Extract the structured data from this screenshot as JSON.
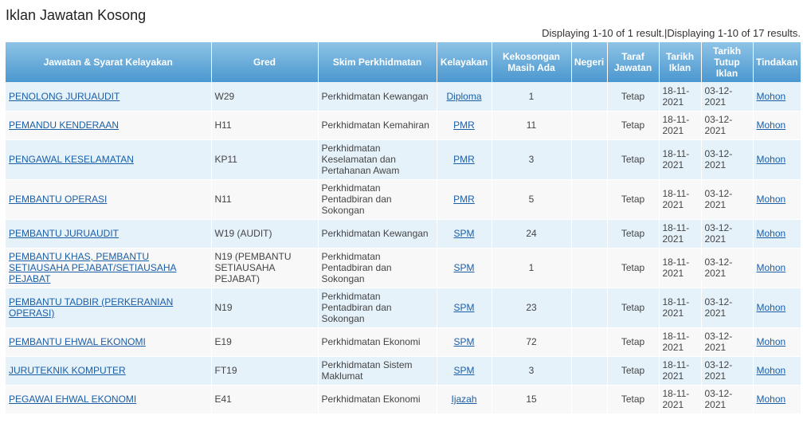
{
  "page": {
    "title": "Iklan Jawatan Kosong",
    "summary": "Displaying 1-10 of 1 result.|Displaying 1-10 of 17 results."
  },
  "table": {
    "headers": {
      "jawatan": "Jawatan & Syarat Kelayakan",
      "gred": "Gred",
      "skim": "Skim Perkhidmatan",
      "kelayakan": "Kelayakan",
      "kekosongan_1": "Kekosongan",
      "kekosongan_2": "Masih Ada",
      "negeri": "Negeri",
      "taraf_1": "Taraf",
      "taraf_2": "Jawatan",
      "tarikh_iklan_1": "Tarikh",
      "tarikh_iklan_2": "Iklan",
      "tarikh_tutup_1": "Tarikh",
      "tarikh_tutup_2": "Tutup",
      "tarikh_tutup_3": "Iklan",
      "tindakan": "Tindakan"
    },
    "rows": [
      {
        "jawatan": "PENOLONG JURUAUDIT",
        "gred": "W29",
        "skim": "Perkhidmatan Kewangan",
        "kelayakan": "Diploma",
        "kekosongan": "1",
        "negeri": "",
        "taraf": "Tetap",
        "tarikh_iklan": "18-11-2021",
        "tarikh_tutup": "03-12-2021",
        "tindakan": "Mohon"
      },
      {
        "jawatan": "PEMANDU KENDERAAN",
        "gred": "H11",
        "skim": "Perkhidmatan Kemahiran",
        "kelayakan": "PMR",
        "kekosongan": "11",
        "negeri": "",
        "taraf": "Tetap",
        "tarikh_iklan": "18-11-2021",
        "tarikh_tutup": "03-12-2021",
        "tindakan": "Mohon"
      },
      {
        "jawatan": "PENGAWAL KESELAMATAN",
        "gred": "KP11",
        "skim": "Perkhidmatan Keselamatan dan Pertahanan Awam",
        "kelayakan": "PMR",
        "kekosongan": "3",
        "negeri": "",
        "taraf": "Tetap",
        "tarikh_iklan": "18-11-2021",
        "tarikh_tutup": "03-12-2021",
        "tindakan": "Mohon"
      },
      {
        "jawatan": "PEMBANTU OPERASI",
        "gred": "N11",
        "skim": "Perkhidmatan Pentadbiran dan Sokongan",
        "kelayakan": "PMR",
        "kekosongan": "5",
        "negeri": "",
        "taraf": "Tetap",
        "tarikh_iklan": "18-11-2021",
        "tarikh_tutup": "03-12-2021",
        "tindakan": "Mohon"
      },
      {
        "jawatan": "PEMBANTU JURUAUDIT",
        "gred": "W19 (AUDIT)",
        "skim": "Perkhidmatan Kewangan",
        "kelayakan": "SPM",
        "kekosongan": "24",
        "negeri": "",
        "taraf": "Tetap",
        "tarikh_iklan": "18-11-2021",
        "tarikh_tutup": "03-12-2021",
        "tindakan": "Mohon"
      },
      {
        "jawatan": "PEMBANTU KHAS, PEMBANTU SETIAUSAHA PEJABAT/SETIAUSAHA PEJABAT",
        "gred": "N19 (PEMBANTU SETIAUSAHA PEJABAT)",
        "skim": "Perkhidmatan Pentadbiran dan Sokongan",
        "kelayakan": "SPM",
        "kekosongan": "1",
        "negeri": "",
        "taraf": "Tetap",
        "tarikh_iklan": "18-11-2021",
        "tarikh_tutup": "03-12-2021",
        "tindakan": "Mohon"
      },
      {
        "jawatan": "PEMBANTU TADBIR (PERKERANIAN OPERASI)",
        "gred": "N19",
        "skim": "Perkhidmatan Pentadbiran dan Sokongan",
        "kelayakan": "SPM",
        "kekosongan": "23",
        "negeri": "",
        "taraf": "Tetap",
        "tarikh_iklan": "18-11-2021",
        "tarikh_tutup": "03-12-2021",
        "tindakan": "Mohon"
      },
      {
        "jawatan": "PEMBANTU EHWAL EKONOMI",
        "gred": "E19",
        "skim": "Perkhidmatan Ekonomi",
        "kelayakan": "SPM",
        "kekosongan": "72",
        "negeri": "",
        "taraf": "Tetap",
        "tarikh_iklan": "18-11-2021",
        "tarikh_tutup": "03-12-2021",
        "tindakan": "Mohon"
      },
      {
        "jawatan": "JURUTEKNIK KOMPUTER",
        "gred": "FT19",
        "skim": "Perkhidmatan Sistem Maklumat",
        "kelayakan": "SPM",
        "kekosongan": "3",
        "negeri": "",
        "taraf": "Tetap",
        "tarikh_iklan": "18-11-2021",
        "tarikh_tutup": "03-12-2021",
        "tindakan": "Mohon"
      },
      {
        "jawatan": "PEGAWAI EHWAL EKONOMI",
        "gred": "E41",
        "skim": "Perkhidmatan Ekonomi",
        "kelayakan": "Ijazah",
        "kekosongan": "15",
        "negeri": "",
        "taraf": "Tetap",
        "tarikh_iklan": "18-11-2021",
        "tarikh_tutup": "03-12-2021",
        "tindakan": "Mohon"
      }
    ]
  },
  "colors": {
    "header_top": "#8ec3e6",
    "header_bottom": "#4a97cf",
    "row_odd": "#e6f2fa",
    "row_even": "#f8f8f8",
    "link": "#1a5ea8"
  }
}
